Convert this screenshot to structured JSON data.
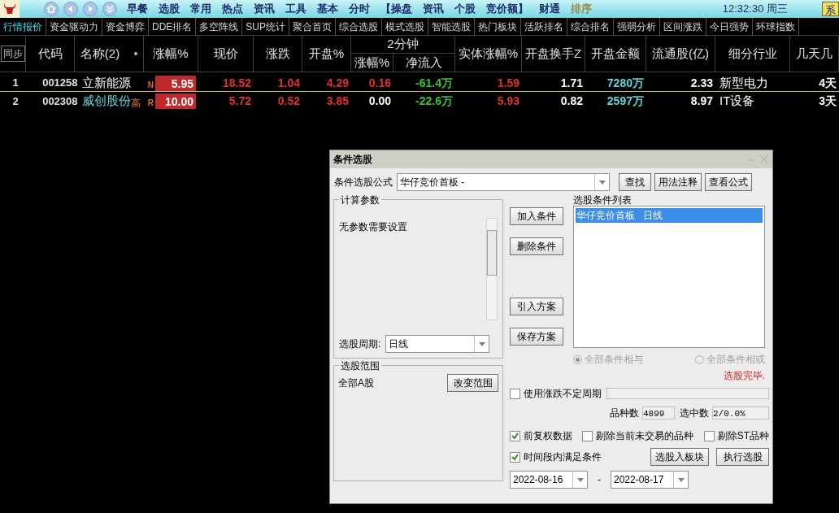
{
  "menu_bar": {
    "items": [
      {
        "label": "早餐",
        "kind": "normal"
      },
      {
        "label": "选股",
        "kind": "normal"
      },
      {
        "label": "常用",
        "kind": "normal"
      },
      {
        "label": "热点",
        "kind": "normal"
      },
      {
        "label": "资讯",
        "kind": "normal"
      },
      {
        "label": "工具",
        "kind": "normal"
      },
      {
        "label": "基本",
        "kind": "normal"
      },
      {
        "label": "分时",
        "kind": "normal"
      },
      {
        "label": "【操盘",
        "kind": "normal"
      },
      {
        "label": "资讯",
        "kind": "normal"
      },
      {
        "label": "个股",
        "kind": "normal"
      },
      {
        "label": "竞价额】",
        "kind": "normal"
      },
      {
        "label": "财通",
        "kind": "normal"
      },
      {
        "label": "排序",
        "kind": "muted"
      }
    ],
    "clock": "12:32:30 周三",
    "system_button": "系"
  },
  "tabs": [
    {
      "label": "行情报价",
      "selected": true
    },
    {
      "label": "资金驱动力",
      "selected": false
    },
    {
      "label": "资金博弈",
      "selected": false
    },
    {
      "label": "DDE排名",
      "selected": false
    },
    {
      "label": "多空阵线",
      "selected": false
    },
    {
      "label": "SUP统计",
      "selected": false
    },
    {
      "label": "聚合首页",
      "selected": false
    },
    {
      "label": "综合选股",
      "selected": false
    },
    {
      "label": "模式选股",
      "selected": false
    },
    {
      "label": "智能选股",
      "selected": false
    },
    {
      "label": "热门板块",
      "selected": false
    },
    {
      "label": "活跃排名",
      "selected": false
    },
    {
      "label": "综合排名",
      "selected": false
    },
    {
      "label": "强弱分析",
      "selected": false
    },
    {
      "label": "区间涨跌",
      "selected": false
    },
    {
      "label": "今日强势",
      "selected": false
    },
    {
      "label": "环球指数",
      "selected": false
    }
  ],
  "table": {
    "group_header": "2分钟",
    "columns": [
      "同步",
      "代码",
      "名称(2)",
      "涨幅%",
      "现价",
      "涨跌",
      "开盘%",
      "涨幅%",
      "净流入",
      "实体涨幅%",
      "开盘换手Z",
      "开盘金额",
      "流通股(亿)",
      "细分行业",
      "几天几"
    ],
    "rows": [
      {
        "cells": [
          {
            "text": "1"
          },
          {
            "text": "001258"
          },
          {
            "text": "立新能源",
            "highlighted": false
          },
          {
            "text": "5.95",
            "tag": "N"
          },
          {
            "text": "18.52",
            "color": "#e03030"
          },
          {
            "text": "1.04",
            "color": "#e03030"
          },
          {
            "text": "4.29",
            "color": "#e03030"
          },
          {
            "text": "0.16",
            "color": "#e03030"
          },
          {
            "text": "-61.4万",
            "color": "#3cc03c"
          },
          {
            "text": "1.59",
            "color": "#e03030"
          },
          {
            "text": "1.71",
            "color": "#ffffff"
          },
          {
            "text": "7280万",
            "color": "#5fd7e0"
          },
          {
            "text": "2.33",
            "color": "#ffffff"
          },
          {
            "text": "新型电力",
            "color": "#ffffff"
          },
          {
            "text": "4天",
            "color": "#ffffff"
          }
        ]
      },
      {
        "cells": [
          {
            "text": "2"
          },
          {
            "text": "002308"
          },
          {
            "text": "威创股份",
            "highlighted": true,
            "suffix": "高"
          },
          {
            "text": "10.00",
            "tag": "R"
          },
          {
            "text": "5.72",
            "color": "#e03030"
          },
          {
            "text": "0.52",
            "color": "#e03030"
          },
          {
            "text": "3.85",
            "color": "#e03030"
          },
          {
            "text": "0.00",
            "color": "#ffffff"
          },
          {
            "text": "-22.6万",
            "color": "#3cc03c"
          },
          {
            "text": "5.93",
            "color": "#e03030"
          },
          {
            "text": "0.82",
            "color": "#ffffff"
          },
          {
            "text": "2597万",
            "color": "#5fd7e0"
          },
          {
            "text": "8.97",
            "color": "#ffffff"
          },
          {
            "text": "IT设备",
            "color": "#ffffff"
          },
          {
            "text": "3天",
            "color": "#ffffff"
          }
        ]
      }
    ]
  },
  "dialog": {
    "title": "条件选股",
    "formula_label": "条件选股公式",
    "formula_value": "华仔竞价首板 -",
    "top_buttons": [
      "查找",
      "用法注释",
      "查看公式"
    ],
    "params_group": "计算参数",
    "params_text": "无参数需要设置",
    "period_label": "选股周期:",
    "period_value": "日线",
    "side_buttons": [
      "加入条件",
      "删除条件",
      "引入方案",
      "保存方案"
    ],
    "list_label": "选股条件列表",
    "list_items": [
      {
        "label": "华仔竞价首板   日线",
        "selected": true
      }
    ],
    "radios": [
      {
        "label": "全部条件相与",
        "selected": true
      },
      {
        "label": "全部条件相或",
        "selected": false
      }
    ],
    "status": "选股完毕.",
    "range_group": "选股范围",
    "range_text": "全部A股",
    "range_button": "改变范围",
    "variable_period": {
      "label": "使用涨跌不定周期",
      "checked": false
    },
    "count_label": "品种数",
    "count_value": "4899",
    "selected_label": "选中数",
    "selected_value": "2/0.0%",
    "options": [
      {
        "label": "前复权数据",
        "checked": true
      },
      {
        "label": "剔除当前未交易的品种",
        "checked": false
      },
      {
        "label": "剔除ST品种",
        "checked": false
      }
    ],
    "time_condition": {
      "label": "时间段内满足条件",
      "checked": true
    },
    "bottom_buttons": [
      "选股入板块",
      "执行选股"
    ],
    "date_from": "2022-08-16",
    "date_separator": "-",
    "date_to": "2022-08-17"
  }
}
